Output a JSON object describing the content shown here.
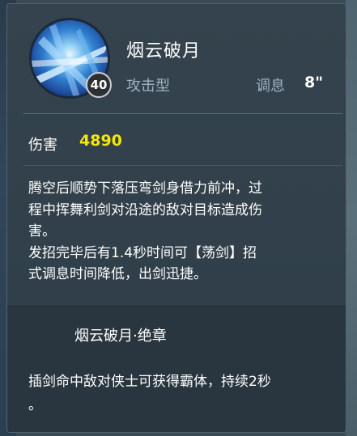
{
  "skill": {
    "name": "烟云破月",
    "level": "40",
    "type": "攻击型",
    "cooldown_label": "调息",
    "cooldown_value": "8\""
  },
  "damage": {
    "label": "伤害",
    "value": "4890"
  },
  "description": {
    "lines": [
      "腾空后顺势下落压弯剑身借力前冲，过",
      "程中挥舞利剑对沿途的敌对目标造成伤",
      "害。",
      "发招完毕后有1.4秒时间可【荡剑】招",
      "式调息时间降低，出剑迅捷。"
    ]
  },
  "upgrade": {
    "title": "烟云破月·绝章",
    "lines": [
      "插剑命中敌对侠士可获得霸体，持续2秒",
      "。"
    ]
  },
  "colors": {
    "damage_value": "#f5e60a",
    "panel_bg": "#2f3d47",
    "muted_text": "#9fb3c2"
  },
  "icons": {
    "skill_icon": "blue-sword-slash-icon",
    "level_badge": "level-badge-icon"
  }
}
